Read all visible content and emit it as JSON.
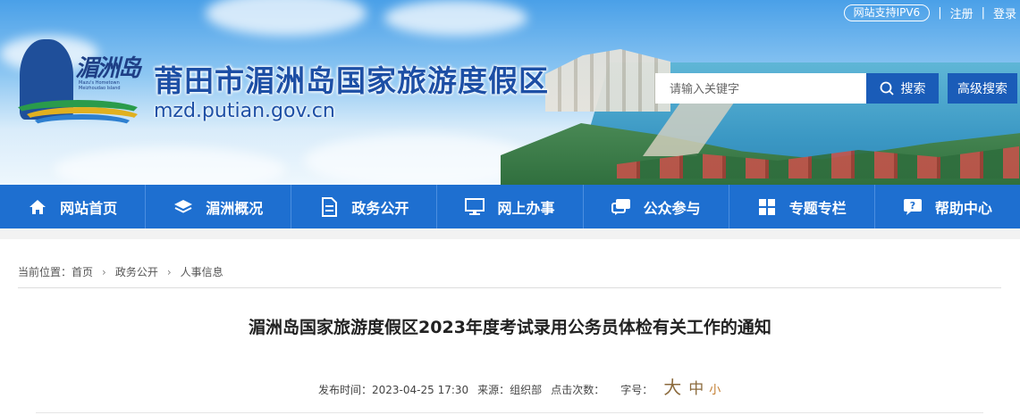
{
  "header": {
    "site_title": "莆田市湄洲岛国家旅游度假区",
    "site_domain": "mzd.putian.gov.cn",
    "logo_chars": "湄洲岛",
    "logo_sub": "Mazu's Hometown Meizhoudao Island",
    "ipv6_label": "网站支持IPV6",
    "register_label": "注册",
    "login_label": "登录",
    "search_placeholder": "请输入关键字",
    "search_button": "搜索",
    "advanced_search": "高级搜索"
  },
  "nav": {
    "items": [
      {
        "label": "网站首页",
        "icon": "home-icon"
      },
      {
        "label": "湄洲概况",
        "icon": "layers-icon"
      },
      {
        "label": "政务公开",
        "icon": "document-icon"
      },
      {
        "label": "网上办事",
        "icon": "monitor-icon"
      },
      {
        "label": "公众参与",
        "icon": "chat-icon"
      },
      {
        "label": "专题专栏",
        "icon": "grid-icon"
      },
      {
        "label": "帮助中心",
        "icon": "help-icon"
      }
    ]
  },
  "breadcrumb": {
    "prefix": "当前位置：",
    "items": [
      "首页",
      "政务公开",
      "人事信息"
    ]
  },
  "article": {
    "title": "湄洲岛国家旅游度假区2023年度考试录用公务员体检有关工作的通知",
    "publish_label": "发布时间：",
    "publish_time": "2023-04-25 17:30",
    "source_label": "来源：",
    "source": "组织部",
    "clicks_label": "点击次数：",
    "font_label": "字号：",
    "font_big": "大",
    "font_mid": "中",
    "font_small": "小"
  },
  "colors": {
    "nav_bg": "#1e6fd0",
    "button_bg": "#1a5cb8",
    "title_blue": "#1d4fa5"
  }
}
